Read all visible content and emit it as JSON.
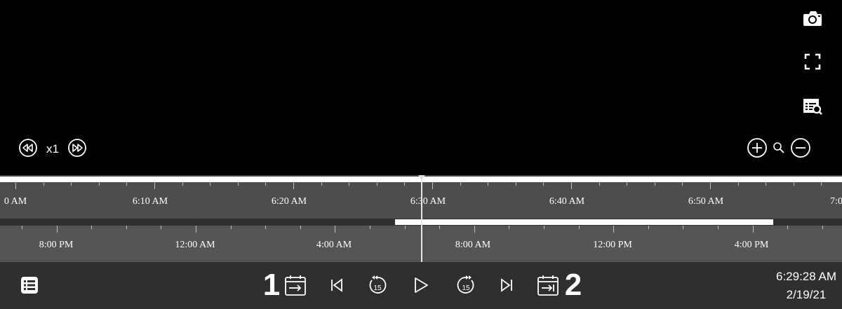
{
  "player": {
    "speed": "x1",
    "icons": {
      "snapshot": "camera-icon",
      "fullscreen": "fullscreen-icon",
      "search": "search-record-icon",
      "rewind": "rewind-icon",
      "fast_forward": "fast-forward-icon",
      "zoom_in": "zoom-in-icon",
      "zoom_out": "zoom-out-icon",
      "magnifier": "magnifier-icon"
    }
  },
  "timeline": {
    "upper_labels": [
      "0 AM",
      "6:10 AM",
      "6:20 AM",
      "6:30 AM",
      "6:40 AM",
      "6:50 AM",
      "7:0"
    ],
    "lower_labels": [
      "8:00 PM",
      "12:00 AM",
      "4:00 AM",
      "8:00 AM",
      "12:00 PM",
      "4:00 PM"
    ]
  },
  "controls": {
    "start_number": "1",
    "end_number": "2",
    "skip_seconds": "15",
    "time": "6:29:28 AM",
    "date": "2/19/21"
  },
  "colors": {
    "background": "#000000",
    "timeline": "#4d4d4d",
    "controls_bar": "#2f2f2f",
    "foreground": "#ffffff"
  }
}
